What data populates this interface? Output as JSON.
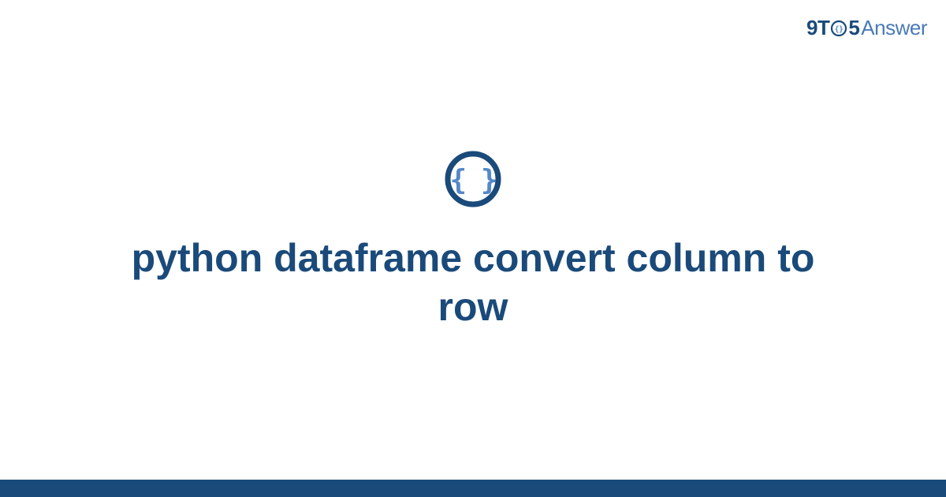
{
  "brand": {
    "nine": "9",
    "t": "T",
    "five": "5",
    "answer": "Answer"
  },
  "title": "python dataframe convert column to row",
  "colors": {
    "primary": "#1a4a7a",
    "secondary": "#4a7ab8",
    "icon_brace": "#5588c8"
  }
}
